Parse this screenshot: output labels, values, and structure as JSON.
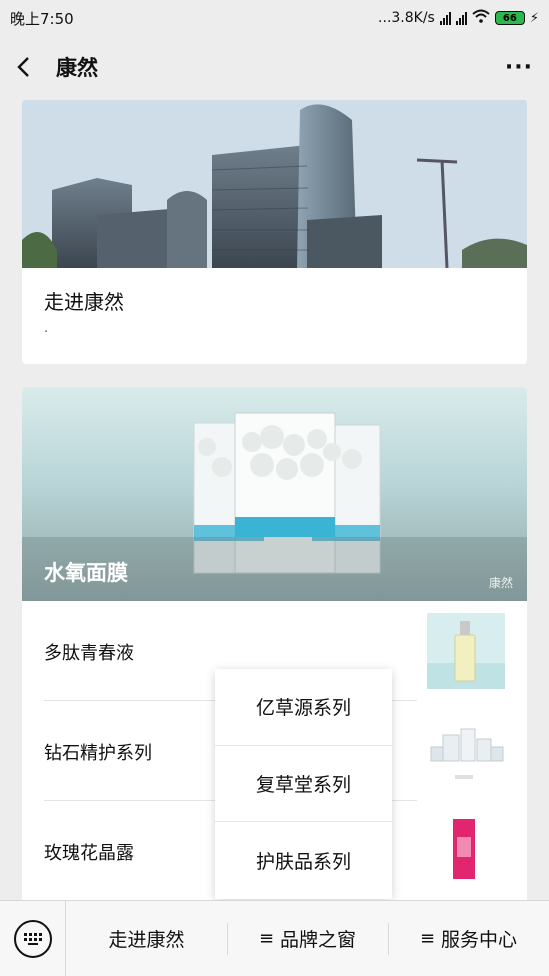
{
  "status": {
    "time": "晚上7:50",
    "network_speed": "...3.8K/s",
    "battery": "66",
    "icons": [
      "signal-hd-icon",
      "signal-hd-icon",
      "wifi-icon",
      "battery-icon",
      "charging-icon"
    ]
  },
  "nav": {
    "title": "康然",
    "more_label": "···"
  },
  "card1": {
    "title": "走进康然",
    "subtitle": "."
  },
  "card2": {
    "hero_title": "水氧面膜",
    "watermark": "康然",
    "items": [
      {
        "label": "多肽青春液"
      },
      {
        "label": "钻石精护系列"
      },
      {
        "label": "玫瑰花晶露"
      }
    ]
  },
  "popup": {
    "items": [
      "亿草源系列",
      "复草堂系列",
      "护肤品系列"
    ]
  },
  "bottom": {
    "tab1": "走进康然",
    "tab2": "品牌之窗",
    "tab3": "服务中心",
    "menu_mark": "≡"
  },
  "colors": {
    "battery": "#2db84d",
    "page_bg": "#ededed"
  }
}
